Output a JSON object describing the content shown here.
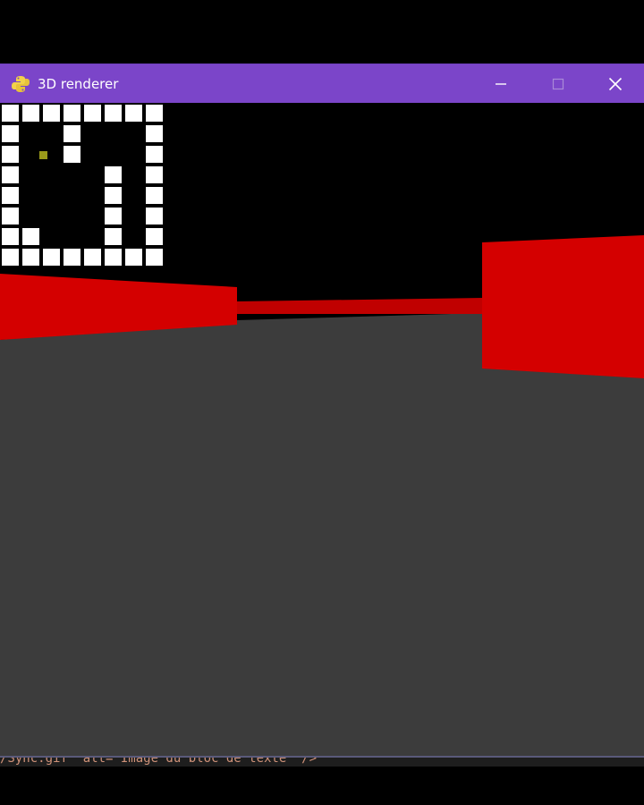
{
  "window": {
    "title": "3D renderer",
    "app_icon": "python-snake-icon",
    "titlebar_color": "#7b45c9",
    "controls": {
      "minimize_icon": "minimize-icon",
      "maximize_icon": "maximize-icon",
      "close_icon": "close-icon"
    }
  },
  "scene": {
    "sky_color": "#000000",
    "floor_color": "#3c3c3c",
    "wall_color": "#d40000",
    "wall_dark_color": "#c00000"
  },
  "minimap": {
    "wall_color": "#ffffff",
    "empty_color": "#000000",
    "player_color": "#9a9a1a",
    "rows": [
      "11111111",
      "10010001",
      "10010001",
      "10000101",
      "10000101",
      "10000101",
      "11000101",
      "11111111"
    ]
  },
  "background_code_fragment": "/Sync.gif\" alt=\"Image du bloc de texte\" />"
}
